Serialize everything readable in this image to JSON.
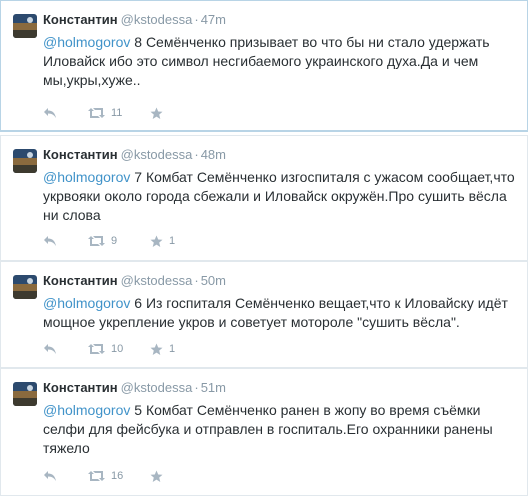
{
  "tweets": [
    {
      "name": "Константин",
      "handle": "@kstodessa",
      "dot": "·",
      "time": "47m",
      "mention": "@holmogorov",
      "text": " 8 Семёнченко призывает во что бы ни стало удержать Иловайск ибо это символ несгибаемого украинского духа.Да и чем мы,укры,хуже..",
      "retweets": "11",
      "favorites": ""
    },
    {
      "name": "Константин",
      "handle": "@kstodessa",
      "dot": "·",
      "time": "48m",
      "mention": "@holmogorov",
      "text": " 7 Комбат Семёнченко изгоспиталя с ужасом сообщает,что укрвояки около города сбежали и Иловайск окружён.Про сушить вёсла ни слова",
      "retweets": "9",
      "favorites": "1"
    },
    {
      "name": "Константин",
      "handle": "@kstodessa",
      "dot": "·",
      "time": "50m",
      "mention": "@holmogorov",
      "text": " 6 Из госпиталя Семёнченко вещает,что к Иловайску идёт мощное укрепление укров и советует мотороле \"сушить вёсла\".",
      "retweets": "10",
      "favorites": "1"
    },
    {
      "name": "Константин",
      "handle": "@kstodessa",
      "dot": "·",
      "time": "51m",
      "mention": "@holmogorov",
      "text": " 5 Комбат Семёнченко ранен в жопу во время съёмки селфи для фейсбука и отправлен в госпиталь.Его охранники ранены тяжело",
      "retweets": "16",
      "favorites": ""
    }
  ],
  "icons": {
    "reply": "reply-icon",
    "retweet": "retweet-icon",
    "favorite": "star-icon"
  },
  "colors": {
    "mention": "#4193c9",
    "name": "#292f33",
    "meta": "#8899a6",
    "icon": "#a8b6c2"
  }
}
